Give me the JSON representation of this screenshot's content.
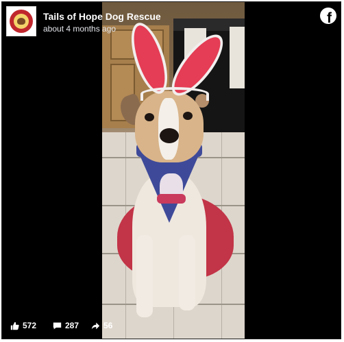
{
  "post": {
    "page_name": "Tails of Hope Dog Rescue",
    "timestamp": "about 4 months ago",
    "platform_icon": "facebook-icon"
  },
  "video": {
    "description_icon": "dog-in-bunny-ears-video"
  },
  "stats": {
    "likes": "572",
    "comments": "287",
    "shares": "56"
  },
  "colors": {
    "background": "#000000",
    "text": "#ffffff",
    "brand_red": "#c0272d"
  }
}
